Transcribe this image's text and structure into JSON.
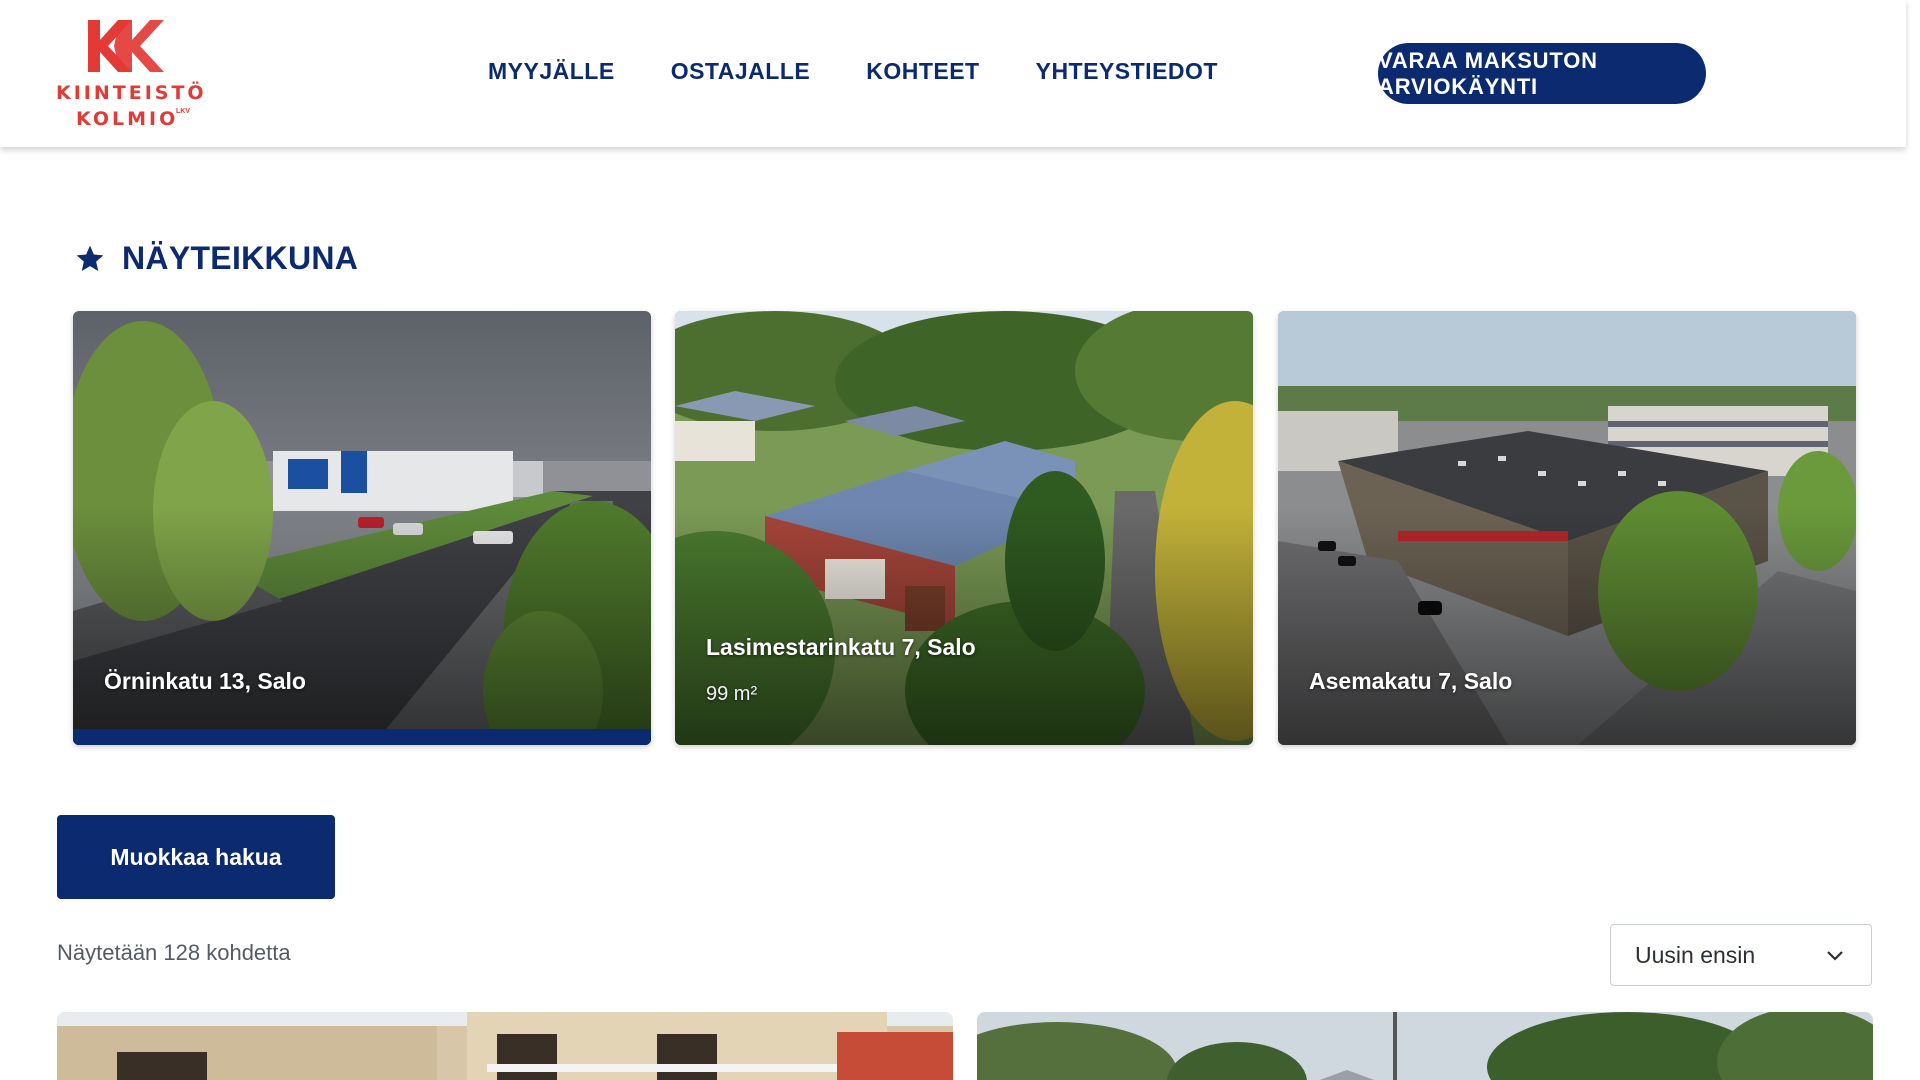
{
  "brand": {
    "logo_line1": "KIINTEISTÖ",
    "logo_line2": "KOLMIO",
    "logo_suffix": "LKV",
    "accent_color": "#e33a35",
    "primary_color": "#0b2a6f"
  },
  "nav": {
    "items": [
      {
        "label": "MYYJÄLLE"
      },
      {
        "label": "OSTAJALLE"
      },
      {
        "label": "KOHTEET"
      },
      {
        "label": "YHTEYSTIEDOT"
      }
    ],
    "cta_label": "VARAA MAKSUTON ARVIOKÄYNTI"
  },
  "showcase": {
    "icon": "star-icon",
    "title": "NÄYTEIKKUNA",
    "cards": [
      {
        "address": "Örninkatu 13, Salo",
        "area": "",
        "active": true
      },
      {
        "address": "Lasimestarinkatu 7, Salo",
        "area": "99 m²",
        "active": false
      },
      {
        "address": "Asemakatu 7, Salo",
        "area": "",
        "active": false
      }
    ]
  },
  "search": {
    "edit_label": "Muokkaa hakua",
    "result_count_text": "Näytetään 128 kohdetta",
    "sort_selected": "Uusin ensin",
    "sort_icon": "chevron-down-icon"
  }
}
